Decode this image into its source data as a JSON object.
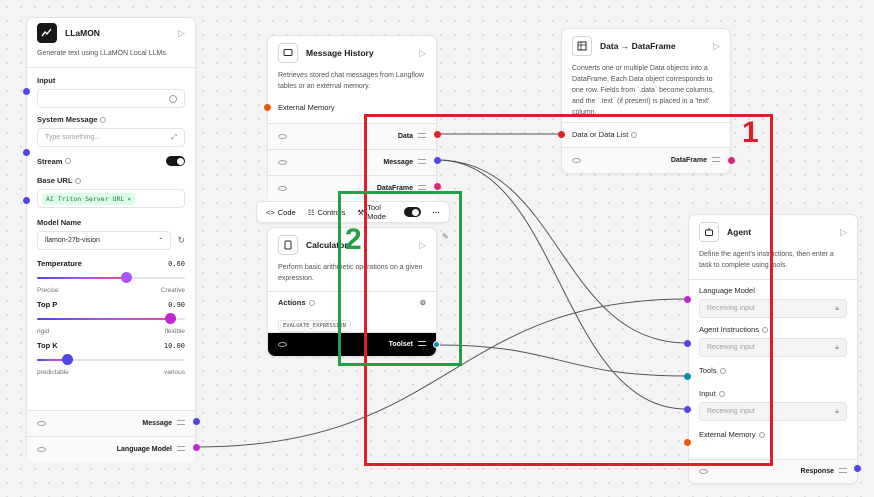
{
  "llamon": {
    "title": "LLaMON",
    "description": "Generate text using LLaMON Local LLMs.",
    "input_label": "Input",
    "system_label": "System Message",
    "system_placeholder": "Type something...",
    "stream_label": "Stream",
    "stream_on": true,
    "base_url_label": "Base URL",
    "base_url_value": "AI Triton Server URL",
    "model_label": "Model Name",
    "model_value": "llamon-27b-vision",
    "temperature_label": "Temperature",
    "temperature_value": "0.60",
    "temperature_fraction": 0.6,
    "temp_left": "Precise",
    "temp_right": "Creative",
    "top_p_label": "Top P",
    "top_p_value": "0.90",
    "top_p_fraction": 0.9,
    "top_p_left": "rigid",
    "top_p_right": "flexible",
    "top_k_label": "Top K",
    "top_k_value": "10.00",
    "top_k_fraction": 0.2,
    "top_k_left": "predictable",
    "top_k_right": "various",
    "output_message": "Message",
    "output_lm": "Language Model"
  },
  "message_history": {
    "title": "Message History",
    "description": "Retrieves stored chat messages from Langflow tables or an external memory.",
    "external_memory": "External Memory",
    "outputs": [
      "Data",
      "Message",
      "DataFrame"
    ]
  },
  "toolbar": {
    "code": "Code",
    "controls": "Controls",
    "tool_mode": "Tool Mode",
    "tool_mode_on": true
  },
  "calculator": {
    "title": "Calculator",
    "description": "Perform basic arithmetic operations on a given expression.",
    "actions_label": "Actions",
    "action_tag": "EVALUATE_EXPRESSION",
    "output": "Toolset"
  },
  "data_to_df": {
    "title": "Data → DataFrame",
    "description": "Converts one or multiple Data objects into a DataFrame. Each Data object corresponds to one row. Fields from `.data` become columns, and the `.text` (if present) is placed in a 'text' column.",
    "input_label": "Data or Data List",
    "output": "DataFrame"
  },
  "agent": {
    "title": "Agent",
    "description": "Define the agent's instructions, then enter a task to complete using tools.",
    "language_model_label": "Language Model",
    "instructions_label": "Agent Instructions",
    "tools_label": "Tools",
    "input_label": "Input",
    "external_memory_label": "External Memory",
    "receiving": "Receiving input",
    "output": "Response"
  },
  "annotations": {
    "box1_label": "1",
    "box2_label": "2",
    "box1_color": "#e11d2a",
    "box2_color": "#22a046"
  },
  "colors": {
    "message_port": "#4f46e5",
    "data_port": "#dc2626",
    "dataframe_port": "#db2777",
    "lm_port": "#c026d3",
    "tool_port": "#0891b2",
    "memory_port": "#ea580c"
  }
}
